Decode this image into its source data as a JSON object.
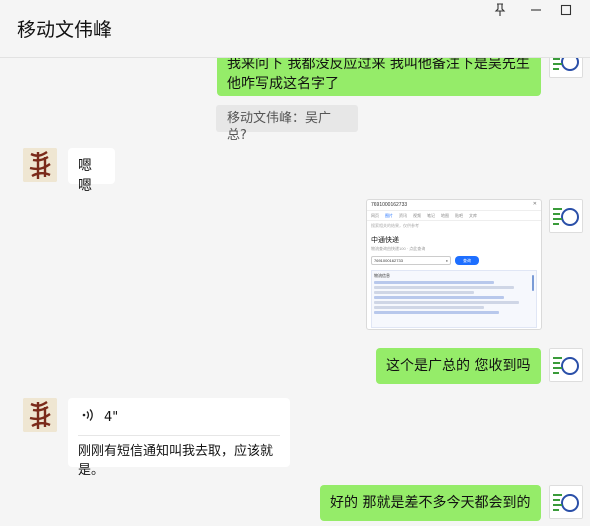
{
  "window": {
    "title": "移动文伟峰",
    "controls": {
      "pin": "pin-icon",
      "minimize": "minimize-icon",
      "maximize": "maximize-icon"
    }
  },
  "colors": {
    "self_bubble": "#95ec69",
    "other_bubble": "#ffffff",
    "background": "#f5f5f5",
    "accent_blue": "#1e6fff"
  },
  "messages": {
    "m1": {
      "sender": "self",
      "text_line1": "我来问下 我都没反应过来 我叫他备注下是吴先生",
      "text_line2": "他咋写成这名字了"
    },
    "m1_quote": {
      "text": "移动文伟峰：吴广总?"
    },
    "m2": {
      "sender": "other",
      "text": "嗯嗯"
    },
    "m3": {
      "sender": "self",
      "type": "image",
      "screenshot": {
        "tracking_top": "7691000162733",
        "tabs": [
          "网页",
          "图片",
          "资讯",
          "视频",
          "笔记",
          "地图",
          "贴吧",
          "文库"
        ],
        "hint": "搜索相关的结果，仅供参考",
        "title": "中通快递",
        "subtitle": "物流查询由快递100 · 点此查询",
        "tracking_input": "7691000162733",
        "query_button": "查询",
        "result_heading": "物流信息",
        "see_more": "展开"
      }
    },
    "m4": {
      "sender": "self",
      "text": "这个是广总的 您收到吗"
    },
    "m5": {
      "sender": "other",
      "type": "voice",
      "duration": "4\"",
      "voice_icon": "voice-wave-icon",
      "transcript": "刚刚有短信通知叫我去取，应该就是。"
    },
    "m6": {
      "sender": "self",
      "text": "好的 那就是差不多今天都会到的"
    }
  }
}
